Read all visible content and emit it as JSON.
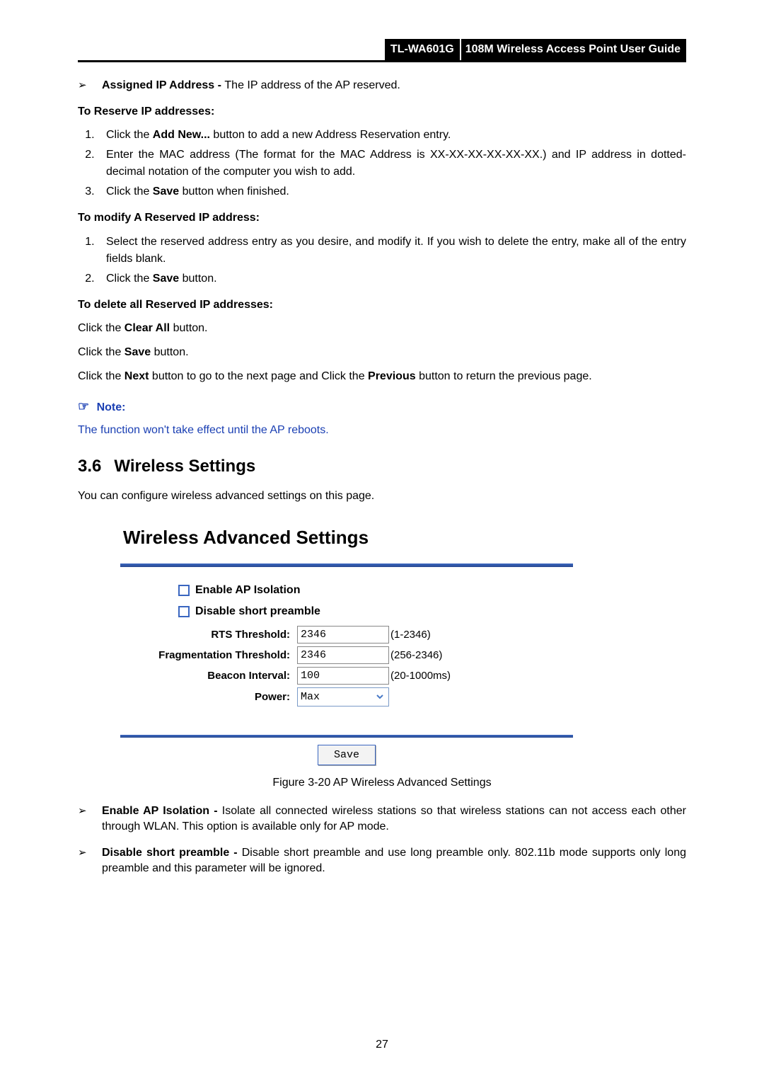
{
  "header": {
    "model": "TL-WA601G",
    "title": "108M Wireless Access Point User Guide"
  },
  "bullet_assigned": {
    "term": "Assigned IP Address - ",
    "desc": "The IP address of the AP reserved."
  },
  "reserve": {
    "heading": "To Reserve IP addresses:",
    "items": [
      {
        "pre": "Click the ",
        "bold": "Add New...",
        "post": " button to add a new Address Reservation entry."
      },
      {
        "full": "Enter the MAC address (The format for the MAC Address is XX-XX-XX-XX-XX-XX.) and IP address in dotted-decimal notation of the computer you wish to add."
      },
      {
        "pre": "Click the ",
        "bold": "Save",
        "post": " button when finished."
      }
    ]
  },
  "modify": {
    "heading": "To modify A Reserved IP address:",
    "items": [
      {
        "full": "Select the reserved address entry as you desire, and modify it. If you wish to delete the entry, make all of the entry fields blank."
      },
      {
        "pre": "Click the ",
        "bold": "Save",
        "post": " button."
      }
    ]
  },
  "delete": {
    "heading": "To delete all Reserved IP addresses:",
    "p1_pre": "Click the ",
    "p1_bold": "Clear All",
    "p1_post": " button.",
    "p2_pre": "Click the ",
    "p2_bold": "Save",
    "p2_post": " button.",
    "p3_a": "Click the ",
    "p3_b": "Next",
    "p3_c": " button to go to the next page and Click the ",
    "p3_d": "Previous",
    "p3_e": " button to return the previous page."
  },
  "note": {
    "label": "Note:",
    "body": "The function won't take effect until the AP reboots."
  },
  "section": {
    "num": "3.6",
    "title": "Wireless Settings",
    "intro": "You can configure wireless advanced settings on this page."
  },
  "figure": {
    "title": "Wireless Advanced Settings",
    "cb1": "Enable AP Isolation",
    "cb2": "Disable short preamble",
    "rows": {
      "rts": {
        "label": "RTS Threshold:",
        "value": "2346",
        "range": "(1-2346)"
      },
      "frag": {
        "label": "Fragmentation Threshold:",
        "value": "2346",
        "range": "(256-2346)"
      },
      "beacon": {
        "label": "Beacon Interval:",
        "value": "100",
        "range": "(20-1000ms)"
      },
      "power": {
        "label": "Power:",
        "value": "Max"
      }
    },
    "save": "Save",
    "caption": "Figure 3-20 AP Wireless Advanced Settings"
  },
  "post_bullets": {
    "b1_term": "Enable AP Isolation - ",
    "b1_desc": "Isolate all connected wireless stations so that wireless stations can not access each other through WLAN. This option is available only for AP mode.",
    "b2_term": "Disable short preamble - ",
    "b2_desc": " Disable short preamble and use long preamble only. 802.11b mode supports only long preamble and this parameter will be ignored."
  },
  "page_number": "27"
}
